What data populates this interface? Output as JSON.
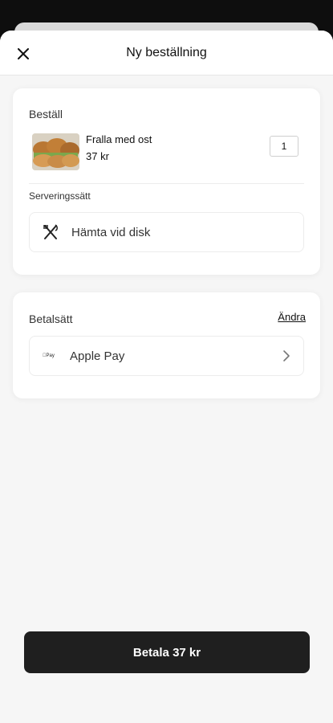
{
  "header": {
    "title": "Ny beställning",
    "close_icon": "close-icon"
  },
  "order": {
    "section_label": "Beställ",
    "item": {
      "name": "Fralla med ost",
      "price": "37 kr",
      "quantity": "1"
    },
    "serving": {
      "section_label": "Serveringssätt",
      "option_label": "Hämta vid disk",
      "icon": "cutlery-icon"
    }
  },
  "payment": {
    "section_label": "Betalsätt",
    "change_label": "Ändra",
    "method_label": "Apple Pay",
    "method_icon_text": "Pay"
  },
  "footer": {
    "pay_button_label": "Betala 37 kr"
  }
}
